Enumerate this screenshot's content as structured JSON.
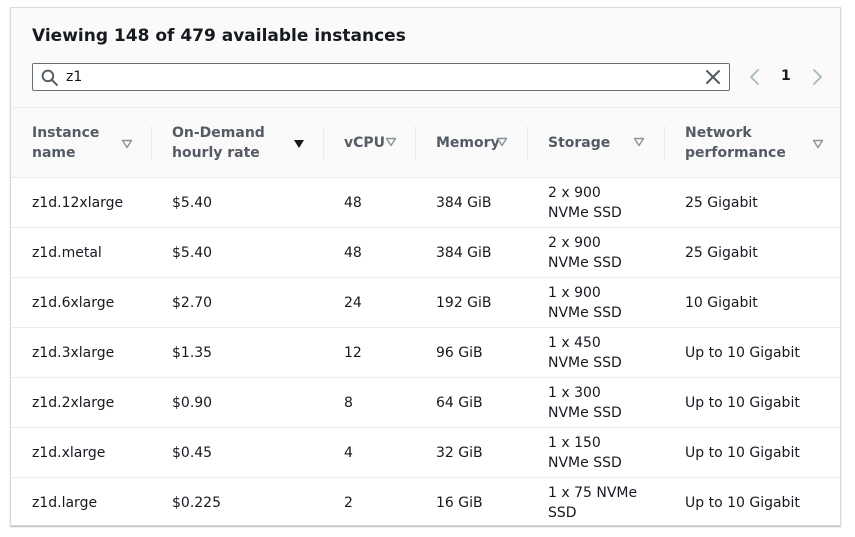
{
  "header": {
    "title": "Viewing 148 of 479 available instances"
  },
  "search": {
    "value": "z1",
    "icon": "search-icon",
    "clear_icon": "close-icon"
  },
  "pagination": {
    "current_page": "1"
  },
  "table": {
    "columns": [
      {
        "label": "Instance name",
        "sort": "unsorted"
      },
      {
        "label": "On-Demand hourly rate",
        "sort": "descending"
      },
      {
        "label": "vCPU",
        "sort": "unsorted"
      },
      {
        "label": "Memory",
        "sort": "unsorted"
      },
      {
        "label": "Storage",
        "sort": "unsorted"
      },
      {
        "label": "Network performance",
        "sort": "unsorted"
      }
    ],
    "rows": [
      {
        "name": "z1d.12xlarge",
        "rate": "$5.40",
        "vcpu": "48",
        "memory": "384 GiB",
        "storage": "2 x 900 NVMe SSD",
        "network": "25 Gigabit"
      },
      {
        "name": "z1d.metal",
        "rate": "$5.40",
        "vcpu": "48",
        "memory": "384 GiB",
        "storage": "2 x 900 NVMe SSD",
        "network": "25 Gigabit"
      },
      {
        "name": "z1d.6xlarge",
        "rate": "$2.70",
        "vcpu": "24",
        "memory": "192 GiB",
        "storage": "1 x 900 NVMe SSD",
        "network": "10 Gigabit"
      },
      {
        "name": "z1d.3xlarge",
        "rate": "$1.35",
        "vcpu": "12",
        "memory": "96 GiB",
        "storage": "1 x 450 NVMe SSD",
        "network": "Up to 10 Gigabit"
      },
      {
        "name": "z1d.2xlarge",
        "rate": "$0.90",
        "vcpu": "8",
        "memory": "64 GiB",
        "storage": "1 x 300 NVMe SSD",
        "network": "Up to 10 Gigabit"
      },
      {
        "name": "z1d.xlarge",
        "rate": "$0.45",
        "vcpu": "4",
        "memory": "32 GiB",
        "storage": "1 x 150 NVMe SSD",
        "network": "Up to 10 Gigabit"
      },
      {
        "name": "z1d.large",
        "rate": "$0.225",
        "vcpu": "2",
        "memory": "16 GiB",
        "storage": "1 x 75 NVMe SSD",
        "network": "Up to 10 Gigabit"
      }
    ]
  },
  "colors": {
    "text": "#16191f",
    "header_text": "#545b64",
    "border": "#eaeded",
    "sort_icon_inactive": "#879596",
    "sort_icon_active": "#16191f"
  }
}
